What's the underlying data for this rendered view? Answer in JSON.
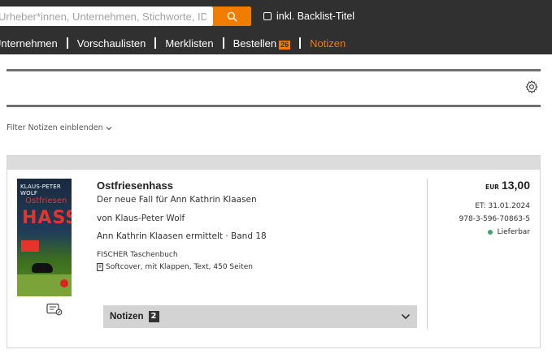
{
  "search": {
    "placeholder": "Urheber*innen, Unternehmen, Stichworte, ID"
  },
  "backlist": {
    "label": "inkl. Backlist-Titel"
  },
  "nav": {
    "items": [
      {
        "label": "Unternehmen"
      },
      {
        "label": "Vorschaulisten"
      },
      {
        "label": "Merklisten"
      },
      {
        "label": "Bestellen",
        "badge": "26"
      },
      {
        "label": "Notizen"
      }
    ]
  },
  "filter": {
    "label": "Filter Notizen einblenden"
  },
  "book": {
    "cover": {
      "author": "KLAUS-PETER WOLF",
      "title_top": "Ostfriesen",
      "title_bottom": "HASS"
    },
    "title": "Ostfriesenhass",
    "subtitle": "Der neue Fall für Ann Kathrin Klaasen",
    "author": "von Klaus-Peter Wolf",
    "series": "Ann Kathrin Klaasen ermittelt · Band 18",
    "publisher": "FISCHER Taschenbuch",
    "format": "Softcover, mit Klappen, Text, 450 Seiten",
    "notes": {
      "label": "Notizen",
      "count": "2"
    },
    "price": {
      "currency": "EUR",
      "value": "13,00"
    },
    "release": "ET: 31.01.2024",
    "isbn": "978-3-596-70863-5",
    "availability": "Lieferbar"
  },
  "colors": {
    "accent": "#f07d00",
    "topbar": "#303030",
    "available": "#3aa66a"
  }
}
